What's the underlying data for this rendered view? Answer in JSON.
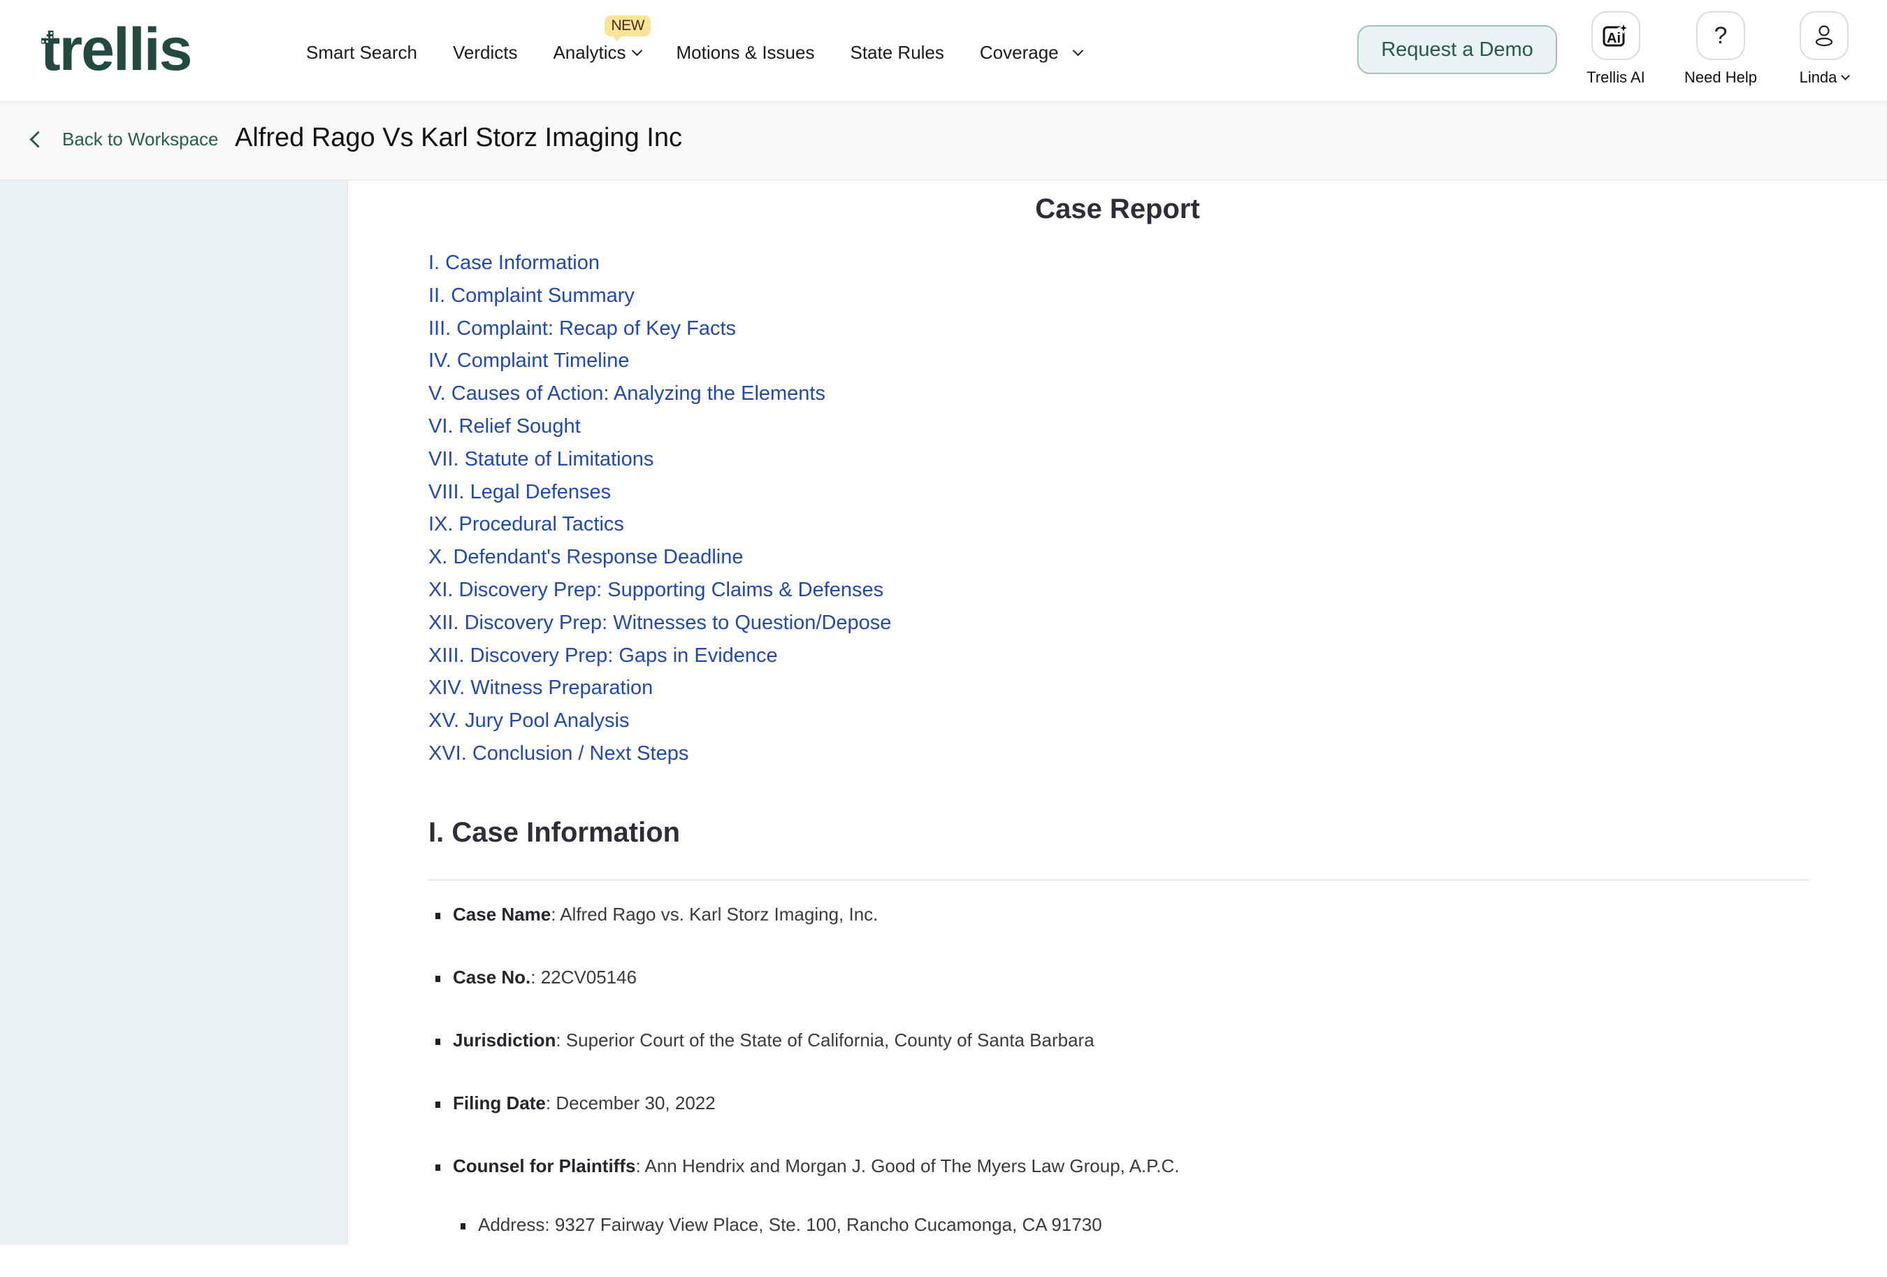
{
  "brand": {
    "logo_text": "trellis",
    "color": "#234a41"
  },
  "nav": {
    "items": [
      {
        "label": "Smart Search",
        "has_dropdown": false
      },
      {
        "label": "Verdicts",
        "has_dropdown": false
      },
      {
        "label": "Analytics",
        "has_dropdown": true,
        "badge": "NEW"
      },
      {
        "label": "Motions & Issues",
        "has_dropdown": false
      },
      {
        "label": "State Rules",
        "has_dropdown": false
      },
      {
        "label": "Coverage",
        "has_dropdown": true
      }
    ],
    "demo_button": "Request a Demo",
    "icons": [
      {
        "icon": "ai-sparkle-icon",
        "label": "Trellis AI"
      },
      {
        "icon": "question-icon",
        "label": "Need Help"
      },
      {
        "icon": "user-icon",
        "label": "Linda",
        "has_dropdown": true
      }
    ]
  },
  "subheader": {
    "back_label": "Back to Workspace",
    "case_title": "Alfred Rago Vs Karl Storz Imaging Inc"
  },
  "report": {
    "title": "Case Report",
    "toc": [
      "I. Case Information",
      "II. Complaint Summary",
      "III. Complaint: Recap of Key Facts",
      "IV. Complaint Timeline",
      "V. Causes of Action: Analyzing the Elements",
      "VI. Relief Sought",
      "VII. Statute of Limitations",
      "VIII. Legal Defenses",
      "IX. Procedural Tactics",
      "X. Defendant's Response Deadline",
      "XI. Discovery Prep: Supporting Claims & Defenses",
      "XII. Discovery Prep: Witnesses to Question/Depose",
      "XIII. Discovery Prep: Gaps in Evidence",
      "XIV. Witness Preparation",
      "XV. Jury Pool Analysis",
      "XVI. Conclusion / Next Steps"
    ],
    "section_heading": "I. Case Information",
    "facts": [
      {
        "label": "Case Name",
        "value": ": Alfred Rago vs. Karl Storz Imaging, Inc."
      },
      {
        "label": "Case No.",
        "value": ": 22CV05146"
      },
      {
        "label": "Jurisdiction",
        "value": ": Superior Court of the State of California, County of Santa Barbara"
      },
      {
        "label": "Filing Date",
        "value": ": December 30, 2022"
      },
      {
        "label": "Counsel for Plaintiffs",
        "value": ": Ann Hendrix and Morgan J. Good of The Myers Law Group, A.P.C."
      },
      {
        "label": "",
        "value": "Address: 9327 Fairway View Place, Ste. 100, Rancho Cucamonga, CA 91730",
        "sub": true
      }
    ]
  },
  "colors": {
    "link": "#2049b5",
    "sidebar_bg": "#e8f1f4",
    "demo_text": "#2a5a45",
    "badge_bg": "#fbe49a"
  }
}
